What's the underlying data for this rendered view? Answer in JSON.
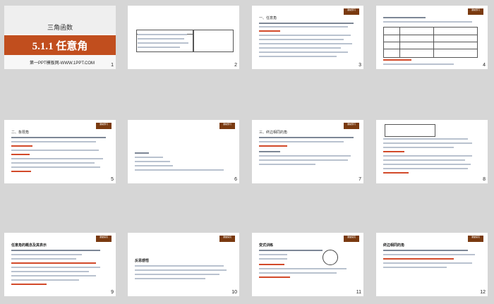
{
  "slides": [
    {
      "id": 1,
      "number": "1",
      "title": "三角函数",
      "heading": "5.1.1 任意角",
      "subtitle": "第一PPT模板网-WWW.1PPT.COM"
    },
    {
      "id": 2,
      "number": "2"
    },
    {
      "id": 3,
      "number": "3",
      "section": "一、任意角"
    },
    {
      "id": 4,
      "number": "4"
    },
    {
      "id": 5,
      "number": "5",
      "section": "二、象限角"
    },
    {
      "id": 6,
      "number": "6"
    },
    {
      "id": 7,
      "number": "7",
      "section": "三、终边相同的角"
    },
    {
      "id": 8,
      "number": "8"
    },
    {
      "id": 9,
      "number": "9",
      "section": "任意角的概念及其表示"
    },
    {
      "id": 10,
      "number": "10",
      "section": "反思感悟"
    },
    {
      "id": 11,
      "number": "11",
      "section": "变式训练"
    },
    {
      "id": 12,
      "number": "12",
      "section": "终边相同的角"
    }
  ],
  "colors": {
    "accent": "#c14e1e",
    "badge": "#7a3a10",
    "highlight": "#d24a2a",
    "canvas": "#d6d6d6"
  }
}
